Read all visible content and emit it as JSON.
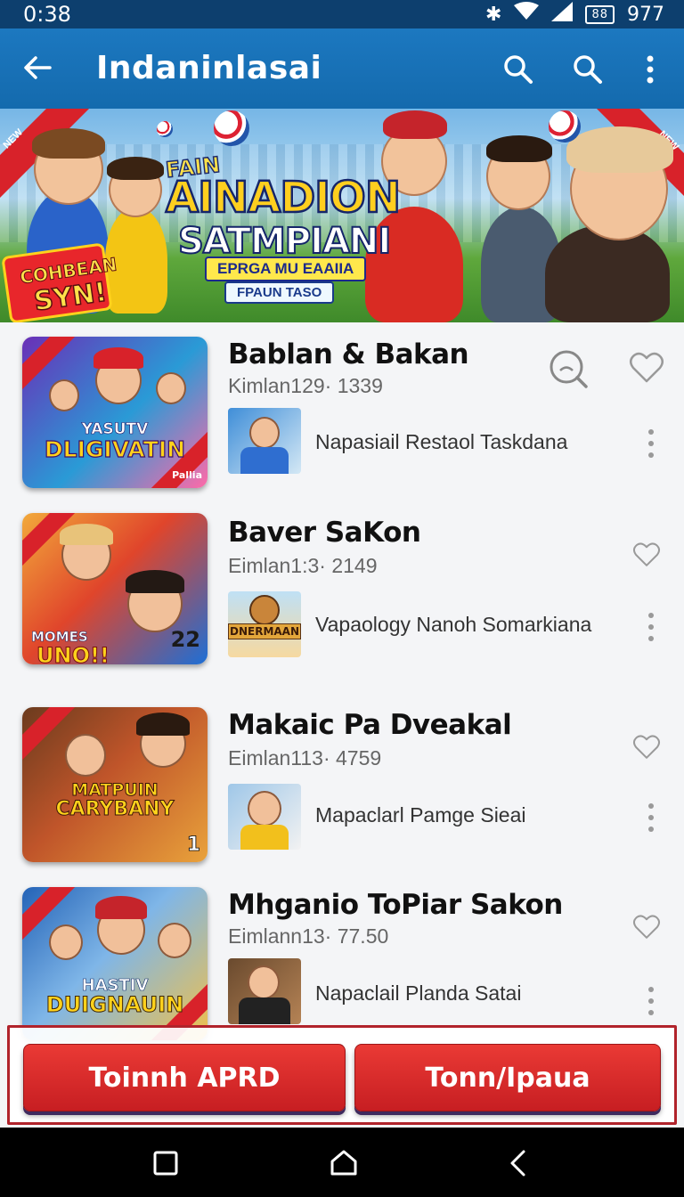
{
  "status_bar": {
    "time": "0:38",
    "battery": "88",
    "signal_text": "977"
  },
  "app_bar": {
    "title": "Indaninlasai"
  },
  "hero": {
    "ribbon_left": "NEW",
    "ribbon_right": "NEW",
    "headline_small": "FAIN",
    "headline_big": "AINADION",
    "headline_mid": "SATMPIANI",
    "pill_1": "EPRGA MU EAAIIA",
    "pill_2": "FPAUN TASO",
    "burst_line1": "COHBEAN",
    "burst_line2": "SYN!"
  },
  "items": [
    {
      "name": "Bablan & Bakan",
      "meta": "Kimlan129· 1339",
      "subline": "Napasiail Restaol Taskdana",
      "thumb_text_1": "YASUTV",
      "thumb_text_2": "DLIGIVATIN",
      "thumb_text_3": "Pallia",
      "thumb_colors": [
        "#6a2fb7",
        "#ff6aa8"
      ]
    },
    {
      "name": "Baver SaKon",
      "meta": "Eimlan1:3· 2149",
      "subline": "Vapaology Nanoh Somarkiana",
      "thumb_text_1": "MOMES",
      "thumb_text_2": "UNO!!",
      "thumb_text_3": "22",
      "mini_text": "DNERMAAN",
      "thumb_colors": [
        "#f2a93b",
        "#1d6fd6"
      ]
    },
    {
      "name": "Makaic Pa Dveakal",
      "meta": "Eimlan113· 4759",
      "subline": "Mapaclarl Pamge Sieai",
      "thumb_text_1": "MATPUIN",
      "thumb_text_2": "CARYBANY",
      "thumb_text_3": "1",
      "thumb_colors": [
        "#6b3b1e",
        "#e9a23b"
      ]
    },
    {
      "name": "Mhganio ToPiar Sakon",
      "meta": "Eimlann13· 77.50",
      "subline": "Napaclail Planda Satai",
      "thumb_text_1": "HASTIV",
      "thumb_text_2": "DUIGNAUIN",
      "thumb_text_3": "",
      "thumb_colors": [
        "#2463b7",
        "#f0c04a"
      ]
    }
  ],
  "actions": {
    "primary_label": "Toinnh APRD",
    "secondary_label": "Tonn/Ipaua"
  },
  "colors": {
    "app_bar": "#1a74bb",
    "status_bar": "#0d3f6e",
    "accent_red": "#d8222a"
  }
}
